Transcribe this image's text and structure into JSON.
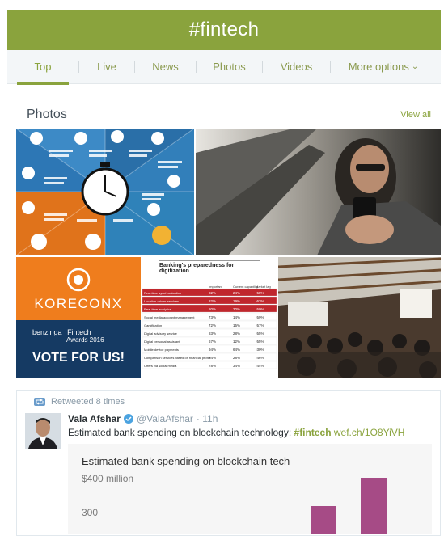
{
  "header": {
    "title": "#fintech"
  },
  "tabs": [
    {
      "label": "Top",
      "active": true
    },
    {
      "label": "Live"
    },
    {
      "label": "News"
    },
    {
      "label": "Photos"
    },
    {
      "label": "Videos"
    },
    {
      "label": "More options"
    }
  ],
  "photos": {
    "title": "Photos",
    "view_all": "View all",
    "koreconx": {
      "brand": "KORECONX",
      "award_brand": "benzinga",
      "award_line1": "Fintech",
      "award_line2": "Awards 2016",
      "vote": "VOTE FOR US!"
    },
    "table": {
      "title": "Banking's preparedness for digitization",
      "headers": [
        "Important",
        "Current capability",
        "Market lag"
      ],
      "rows": [
        [
          "Real-time synchronization",
          "82%",
          "24%",
          "-58%"
        ],
        [
          "Location-driven services",
          "82%",
          "19%",
          "-63%"
        ],
        [
          "Real-time analytics",
          "80%",
          "30%",
          "-50%"
        ],
        [
          "Social media account management",
          "73%",
          "14%",
          "-59%"
        ],
        [
          "Gamification",
          "72%",
          "15%",
          "-57%"
        ],
        [
          "Digital advisory service",
          "83%",
          "28%",
          "-55%"
        ],
        [
          "Digital personal assistant",
          "67%",
          "12%",
          "-55%"
        ],
        [
          "Mobile device payments",
          "94%",
          "64%",
          "-30%"
        ],
        [
          "Comparison services based on financial profile",
          "74%",
          "28%",
          "-46%"
        ],
        [
          "Offers via social media",
          "78%",
          "34%",
          "-44%"
        ]
      ]
    }
  },
  "tweet": {
    "retweet_text": "Retweeted 8 times",
    "name": "Vala Afshar",
    "handle": "@ValaAfshar",
    "time": "· 11h",
    "text": "Estimated bank spending on blockchain technology: ",
    "hashtag": "#fintech",
    "link": "wef.ch/1O8YiVH",
    "embed": {
      "title": "Estimated bank spending on blockchain tech",
      "y_label_top": "$400 million",
      "y_label_mid": "300"
    }
  },
  "colors": {
    "accent": "#8aa33d",
    "bar": "#a64b86"
  }
}
